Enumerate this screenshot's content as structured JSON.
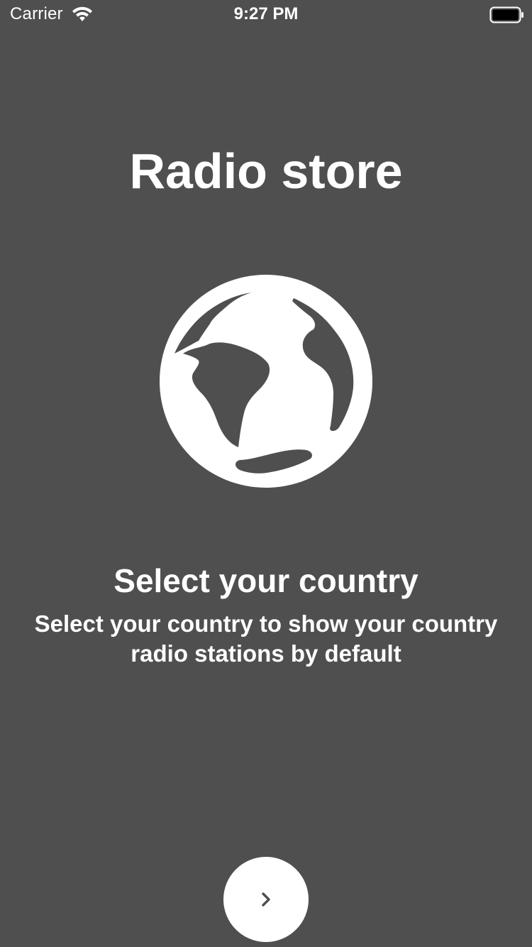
{
  "status_bar": {
    "carrier": "Carrier",
    "time": "9:27 PM",
    "wifi_icon": "wifi-icon",
    "battery_icon": "battery-icon"
  },
  "onboarding": {
    "title": "Radio store",
    "icon": "globe-icon",
    "heading": "Select your country",
    "description": "Select your country to show your country radio stations by default"
  },
  "next_button": {
    "icon": "chevron-right-icon",
    "background": "#ffffff",
    "icon_color": "#4f4f4f"
  },
  "colors": {
    "background": "#4f4f4f",
    "foreground": "#ffffff"
  }
}
